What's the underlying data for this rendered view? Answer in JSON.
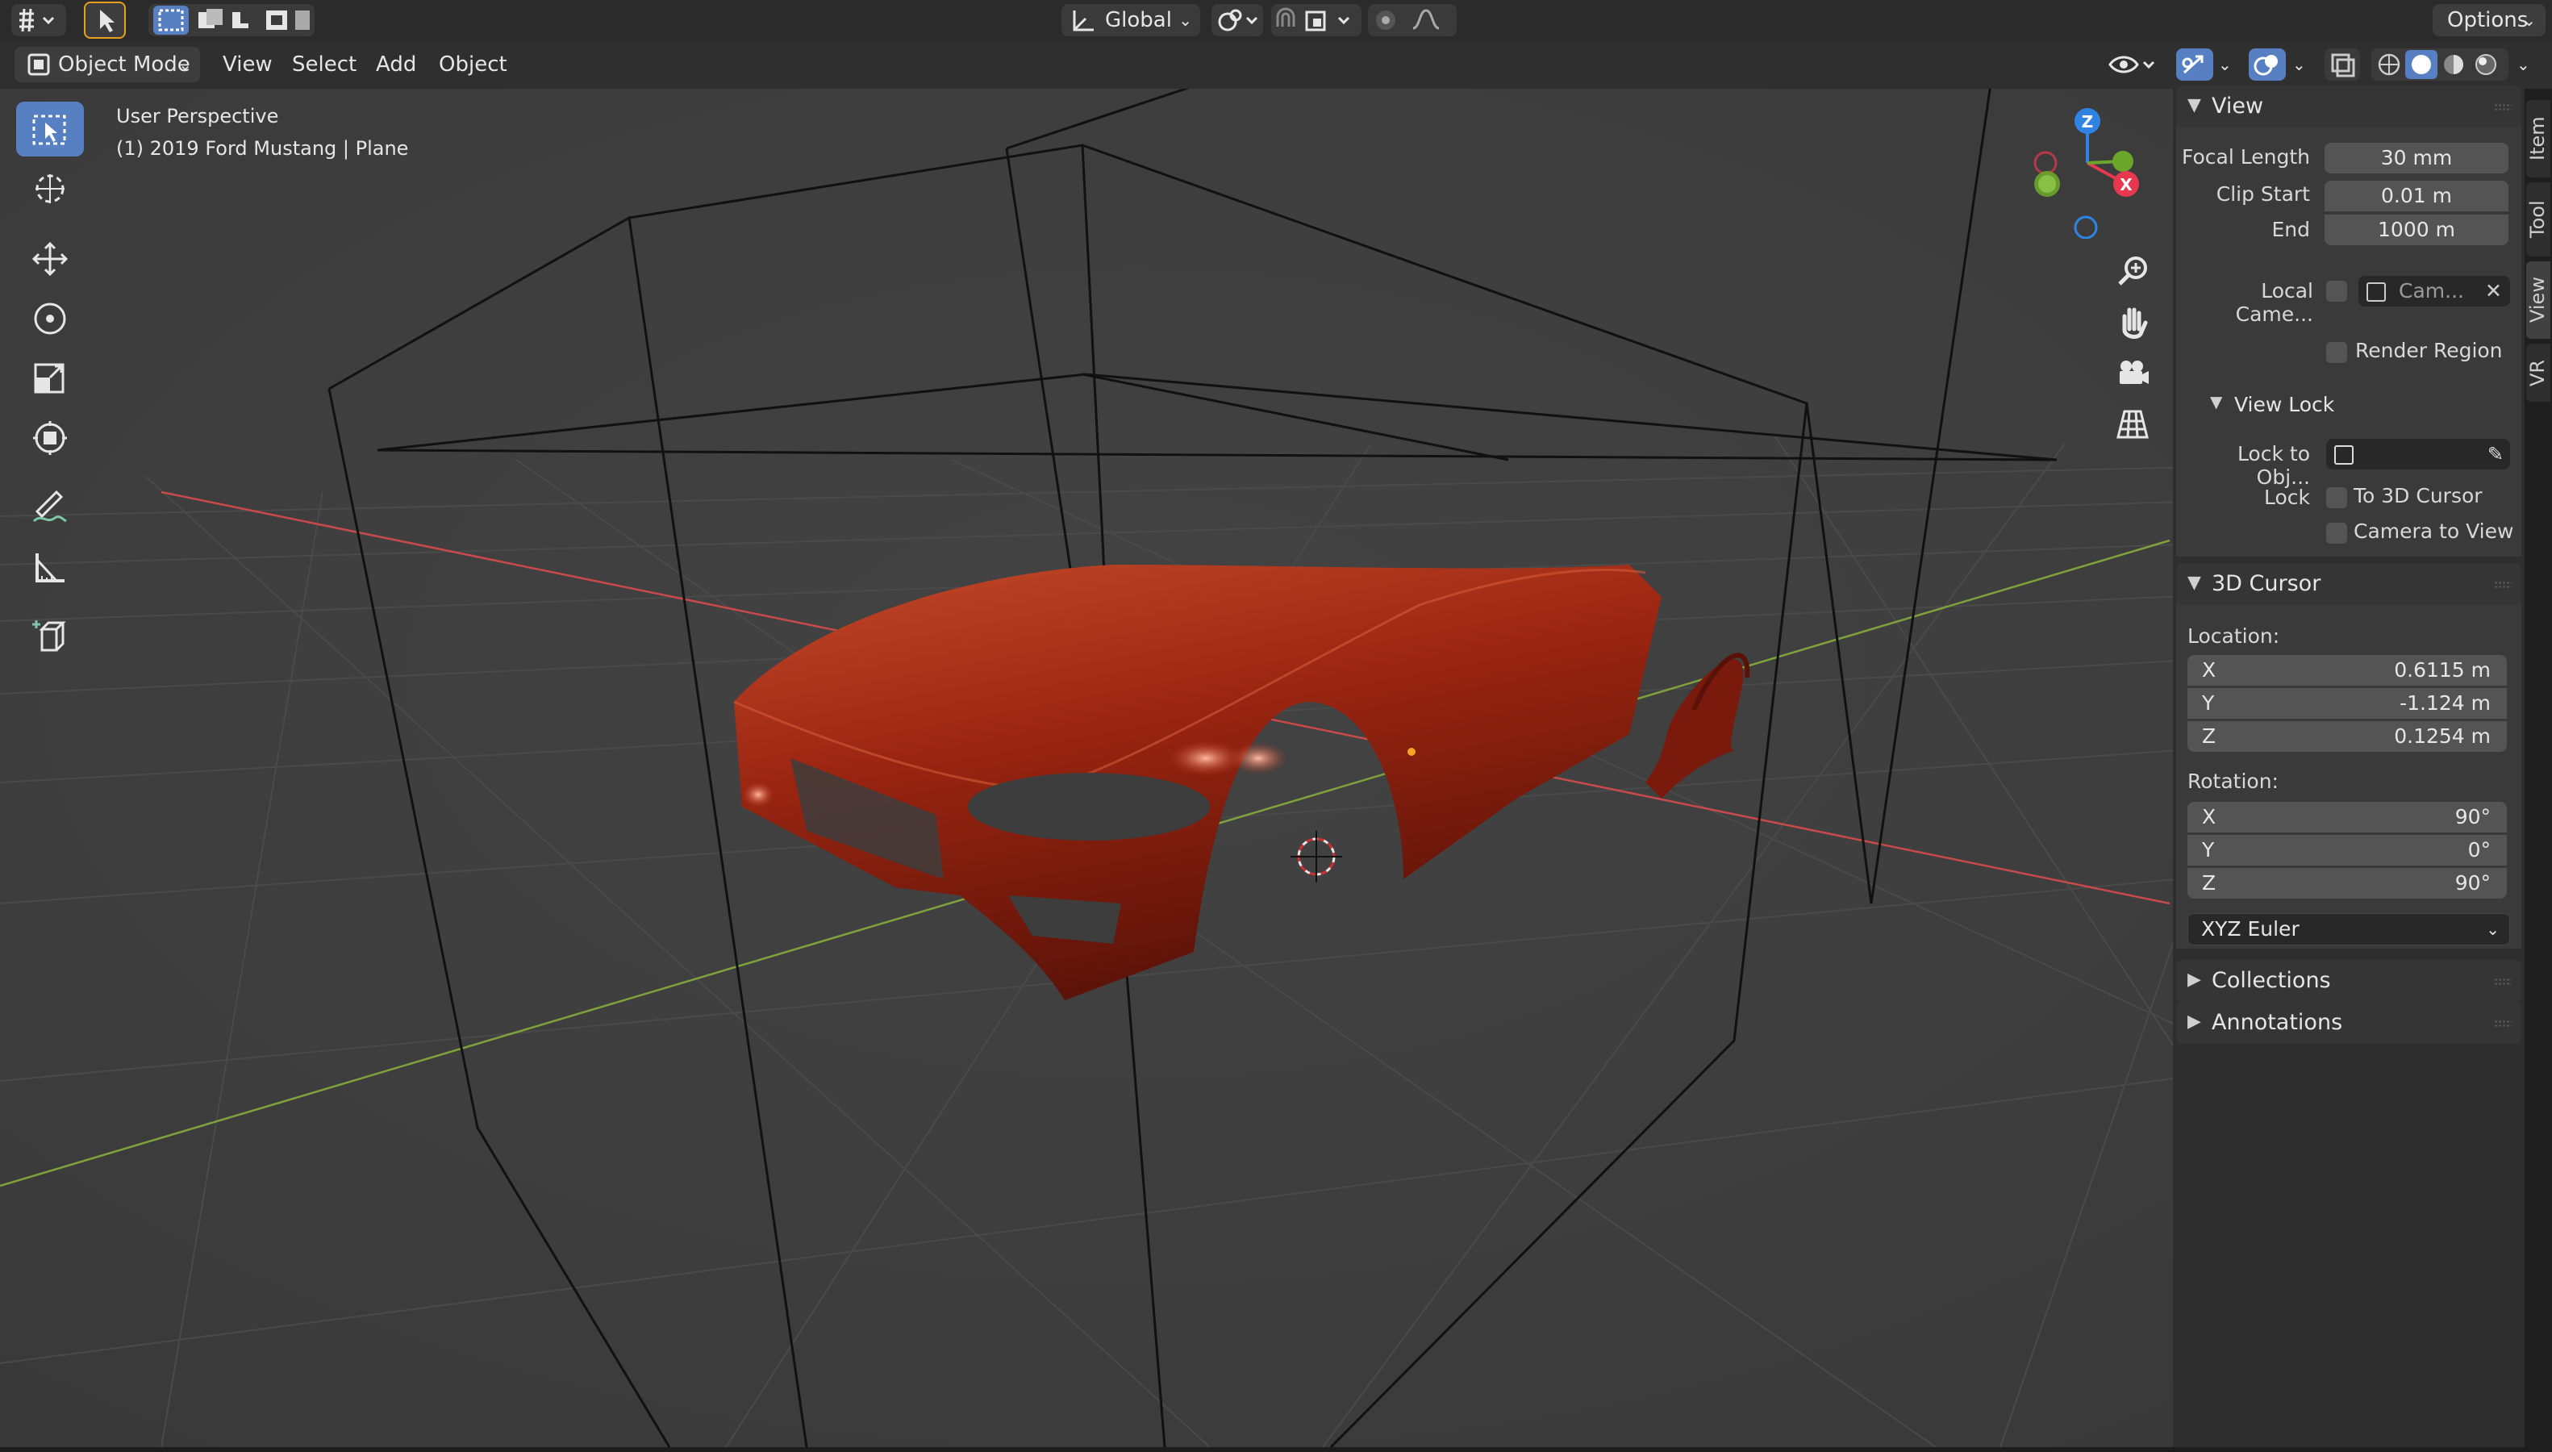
{
  "topbar": {
    "orientation": "Global",
    "options": "Options"
  },
  "header": {
    "mode": "Object Mode",
    "menus": [
      "View",
      "Select",
      "Add",
      "Object"
    ]
  },
  "viewport": {
    "perspective": "User Perspective",
    "object_info": "(1) 2019 Ford Mustang | Plane",
    "gizmo": {
      "z": "Z",
      "x": "X"
    },
    "car_color": "#b5321a"
  },
  "tabs": [
    "Item",
    "Tool",
    "View",
    "VR"
  ],
  "sidebar": {
    "view_panel": {
      "title": "View",
      "focal_length_label": "Focal Length",
      "focal_length": "30 mm",
      "clip_start_label": "Clip Start",
      "clip_start": "0.01 m",
      "end_label": "End",
      "end": "1000 m",
      "local_camera_label": "Local Came...",
      "local_camera_value": "Cam...",
      "render_region": "Render Region",
      "view_lock_title": "View Lock",
      "lock_to_obj_label": "Lock to Obj...",
      "lock_label": "Lock",
      "to_3d_cursor": "To 3D Cursor",
      "camera_to_view": "Camera to View"
    },
    "cursor_panel": {
      "title": "3D Cursor",
      "location_label": "Location:",
      "location": [
        {
          "axis": "X",
          "value": "0.6115 m"
        },
        {
          "axis": "Y",
          "value": "-1.124 m"
        },
        {
          "axis": "Z",
          "value": "0.1254 m"
        }
      ],
      "rotation_label": "Rotation:",
      "rotation": [
        {
          "axis": "X",
          "value": "90°"
        },
        {
          "axis": "Y",
          "value": "0°"
        },
        {
          "axis": "Z",
          "value": "90°"
        }
      ],
      "rotation_mode": "XYZ Euler"
    },
    "collections": "Collections",
    "annotations": "Annotations"
  },
  "colors": {
    "active_tool": "#5680c2",
    "axis_red": "#c84a4a",
    "axis_green": "#7ea33c",
    "gizmo_x": "#e8384f",
    "gizmo_y": "#6ba52a",
    "gizmo_z": "#2f84e3"
  }
}
